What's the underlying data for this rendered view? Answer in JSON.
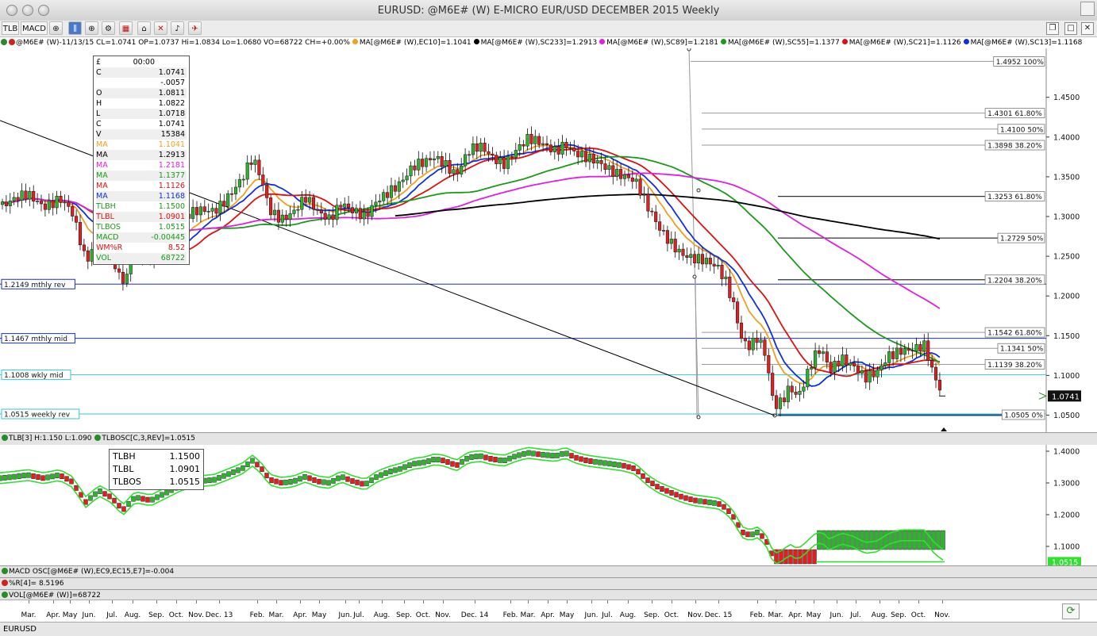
{
  "window": {
    "title": "EURUSD: @M6E# (W) E-MICRO EUR/USD DECEMBER 2015 Weekly"
  },
  "toolbar": {
    "tlb_label": "TLB",
    "macd_label": "MACD"
  },
  "infobar": {
    "symbol_info": "@M6E# (W)-11/13/15 CL=1.0741 OP=1.0737 Hi=1.0834 Lo=1.0680 VO=68722 CH=+0.00%",
    "ma_items": [
      {
        "text": "MA[@M6E# (W),EC10]=1.1041",
        "color": "#f0a020"
      },
      {
        "text": "MA[@M6E# (W),SC233]=1.2913",
        "color": "#000000"
      },
      {
        "text": "MA[@M6E# (W),SC89]=1.2181",
        "color": "#e020e0"
      },
      {
        "text": "MA[@M6E# (W),SC55]=1.1377",
        "color": "#1a9a1a"
      },
      {
        "text": "MA[@M6E# (W),SC21]=1.1126",
        "color": "#e01010"
      },
      {
        "text": "MA[@M6E# (W),SC13]=1.1168",
        "color": "#1030e0"
      }
    ]
  },
  "data_window": {
    "header_sym": "£",
    "header_time": "00:00",
    "rows": [
      {
        "label": "C",
        "value": "1.0741",
        "color": "#000000"
      },
      {
        "label": "",
        "value": "-.0057",
        "color": "#000000"
      },
      {
        "label": "O",
        "value": "1.0811",
        "color": "#000000"
      },
      {
        "label": "H",
        "value": "1.0822",
        "color": "#000000"
      },
      {
        "label": "L",
        "value": "1.0718",
        "color": "#000000"
      },
      {
        "label": "C",
        "value": "1.0741",
        "color": "#000000"
      },
      {
        "label": "V",
        "value": "15384",
        "color": "#000000"
      },
      {
        "label": "MA",
        "value": "1.1041",
        "color": "#f0a020"
      },
      {
        "label": "MA",
        "value": "1.2913",
        "color": "#000000"
      },
      {
        "label": "MA",
        "value": "1.2181",
        "color": "#e020e0"
      },
      {
        "label": "MA",
        "value": "1.1377",
        "color": "#1a9a1a"
      },
      {
        "label": "MA",
        "value": "1.1126",
        "color": "#e01010"
      },
      {
        "label": "MA",
        "value": "1.1168",
        "color": "#1030e0"
      },
      {
        "label": "TLBH",
        "value": "1.1500",
        "color": "#1a9a1a"
      },
      {
        "label": "TLBL",
        "value": "1.0901",
        "color": "#e01010"
      },
      {
        "label": "TLBOS",
        "value": "1.0515",
        "color": "#1a9a1a"
      },
      {
        "label": "MACD",
        "value": "-0.00445",
        "color": "#1a9a1a"
      },
      {
        "label": "WM%R",
        "value": "8.52",
        "color": "#e01010"
      },
      {
        "label": "VOL",
        "value": "68722",
        "color": "#1a9a1a"
      }
    ]
  },
  "hlines": [
    {
      "label": "1.2149 mthly rev",
      "value": 1.2149,
      "color": "#1c2bd8"
    },
    {
      "label": "1.1467 mthly mid",
      "value": 1.1467,
      "color": "#1c2bd8"
    },
    {
      "label": "1.1008 wkly mid",
      "value": 1.1008,
      "color": "#35c6d8"
    },
    {
      "label": "1.0515 weekly rev",
      "value": 1.0515,
      "color": "#35c6d8"
    }
  ],
  "fib_labels": [
    {
      "text": "1.4952 100%",
      "value": 1.4952
    },
    {
      "text": "1.4301 61.80%",
      "value": 1.4301
    },
    {
      "text": "1.4100 50%",
      "value": 1.41
    },
    {
      "text": "1.3898 38.20%",
      "value": 1.3898
    },
    {
      "text": "1.3253 61.80%",
      "value": 1.3253
    },
    {
      "text": "1.2729 50%",
      "value": 1.2729
    },
    {
      "text": "1.2204 38.20%",
      "value": 1.2204
    },
    {
      "text": "1.1542 61.80%",
      "value": 1.1542
    },
    {
      "text": "1.1341 50%",
      "value": 1.1341
    },
    {
      "text": "1.1139 38.20%",
      "value": 1.1139
    },
    {
      "text": "1.0505 0%",
      "value": 1.0505
    }
  ],
  "price_axis": {
    "ticks": [
      "1.4500",
      "1.4000",
      "1.3500",
      "1.3000",
      "1.2500",
      "1.2000",
      "1.1500",
      "1.1000",
      "1.0500"
    ],
    "last_price": "1.0741"
  },
  "tlb_header": {
    "text1": "TLB[3] H:1.150 L:1.090",
    "text2": "TLBOSC[C,3,REV]=1.0515"
  },
  "tlb_window": {
    "rows": [
      {
        "label": "TLBH",
        "value": "1.1500"
      },
      {
        "label": "TLBL",
        "value": "1.0901"
      },
      {
        "label": "TLBOS",
        "value": "1.0515"
      }
    ]
  },
  "tlb_axis": {
    "ticks": [
      "1.4000",
      "1.3000",
      "1.2000",
      "1.1000"
    ],
    "current": "1.0515"
  },
  "indicators": {
    "macd": "MACD OSC[@M6E# (W),EC9,EC15,E7]=-0.004",
    "wmr": "%R[4]=  8.5196",
    "vol": "VOL[@M6E# (W)]=68722"
  },
  "x_axis": {
    "labels": [
      "Mar.",
      "Apr.",
      "May",
      "Jun.",
      "Jul.",
      "Aug.",
      "Sep.",
      "Oct.",
      "Nov.",
      "Dec. 13",
      "Feb.",
      "Mar.",
      "Apr.",
      "May",
      "Jun.",
      "Jul.",
      "Aug.",
      "Sep.",
      "Oct.",
      "Nov.",
      "Dec. 14",
      "Feb.",
      "Mar.",
      "Apr.",
      "May",
      "Jun.",
      "Jul.",
      "Aug.",
      "Sep.",
      "Oct.",
      "Nov.",
      "Dec. 15",
      "Feb.",
      "Mar.",
      "Apr.",
      "May",
      "Jun.",
      "Jul.",
      "Aug.",
      "Sep.",
      "Oct.",
      "Nov."
    ]
  },
  "status": {
    "symbol": "EURUSD"
  }
}
